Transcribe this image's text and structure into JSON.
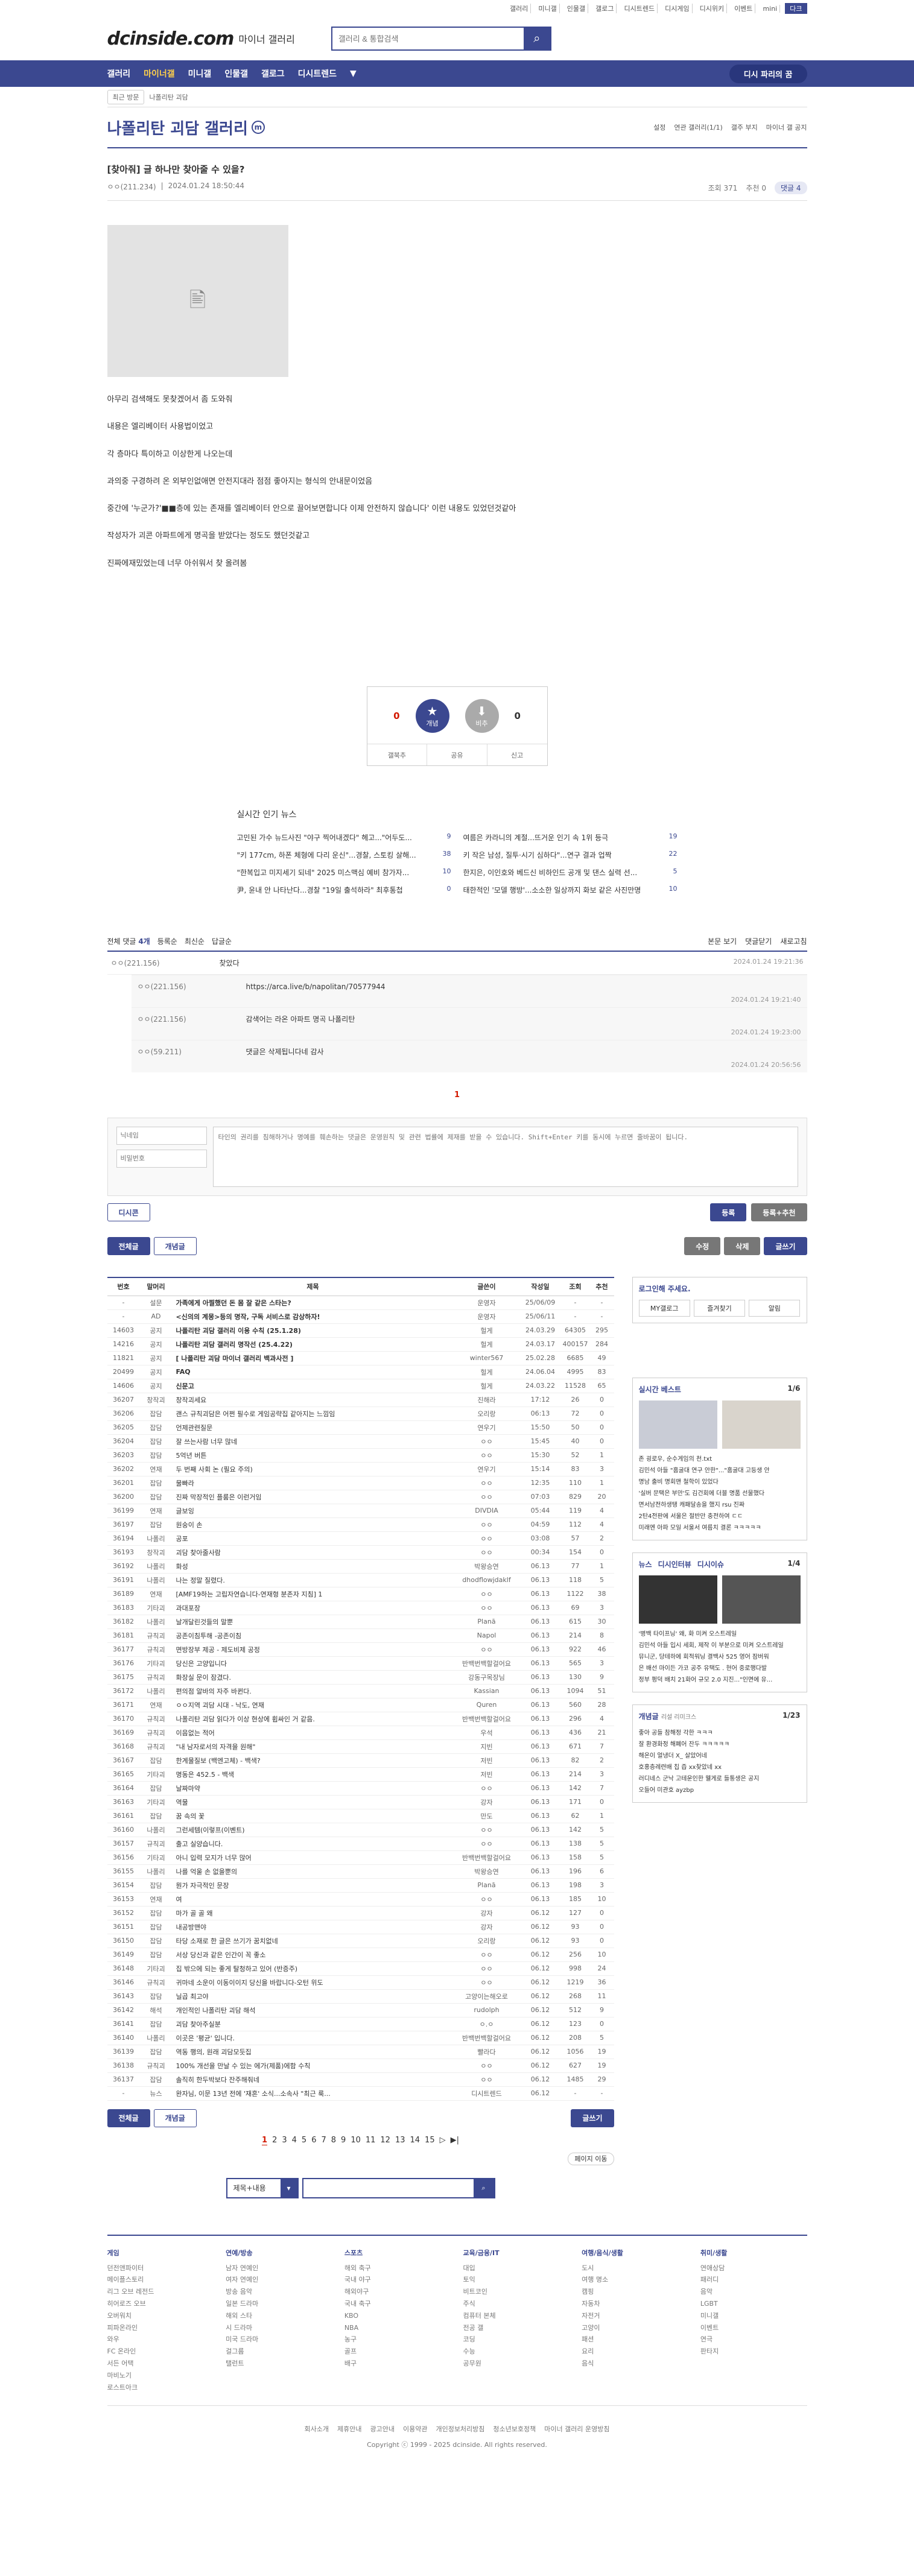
{
  "top_links": [
    "갤러리",
    "미니갤",
    "인물갤",
    "갤로그",
    "디시트렌드",
    "디시게임",
    "디시위키",
    "이벤트",
    "mini",
    "다크"
  ],
  "logo": "dcinside.com",
  "logo_sub": "마이너 갤러리",
  "search_placeholder": "갤러리 & 통합검색",
  "gnb": [
    "갤러리",
    "마이너갤",
    "미니갤",
    "인물갤",
    "갤로그",
    "디시트렌드",
    "▼"
  ],
  "gnb_right": "디시 파리의 꿈",
  "subbar": {
    "recent": "최근 방문",
    "gall": "나폴리탄 괴담"
  },
  "gallery": {
    "title": "나폴리탄 괴담 갤러리",
    "opts": [
      "설정",
      "연관 갤러리(1/1)",
      "갤주 부지",
      "마이너 갤 공지"
    ]
  },
  "post": {
    "title": "[찾아줘] 글 하나만 찾아줄 수 있을?",
    "nick": "ㅇㅇ(211.234)",
    "date": "2024.01.24 18:50:44",
    "views": "조회 371",
    "reco": "추천 0",
    "cmt_badge": "댓글 4",
    "lines": [
      "아무리 검색해도 못찾겠어서 좀 도와줘",
      "내용은 엘리베이터 사용법이었고",
      "각 층마다 특이하고 이상한게 나오는데",
      "과의중 구경하려 온 외부인없애면 안전지대라 점점 좋아지는 형식의 안내문이었음",
      "중간에 '누군가?'■■층에 있는 존재를 엘리베이터 안으로 끌어보면합니다 이제 안전하지 않습니다' 이런 내용도 있었던것같아",
      "작성자가 괴콘 아파트에게 명곡을 받았다는 정도도 했던것같고",
      "진짜에재밌었는데 너무 아쉬워서 찾 올려봄"
    ]
  },
  "reco": {
    "up": "0",
    "fix": "0",
    "down": "0",
    "up_label": "개념",
    "down_label": "비추",
    "b1": "갤북추",
    "b2": "공유",
    "b3": "신고"
  },
  "news": {
    "title": "실시간 인기 뉴스",
    "items": [
      {
        "t": "고민된 가수 뉴드사진 \"야구 찍어내겠다\" 헤고...\"어두도...",
        "c": "9"
      },
      {
        "t": "여름은 카라니의 계절...뜨거운 인기 속 1위 등극",
        "c": "19"
      },
      {
        "t": "\"키 177cm, 하폰 체형에 다리 운신\"...경찰, 스토킹 살해...",
        "c": "38"
      },
      {
        "t": "키 작은 남성, 질투·시기 심하다\"...연구 결과 업짝",
        "c": "22"
      },
      {
        "t": "\"한복입고 미지세기 되네\" 2025 미스맥심 예비 참가자...",
        "c": "10"
      },
      {
        "t": "한지은, 이인호와 베드신 비하인드 공개 및 댄스 실력 선...",
        "c": "5"
      },
      {
        "t": "尹, 윤내 안 나타난다...경찰 \"19일 출석하라\" 최후통첩",
        "c": "0"
      },
      {
        "t": "태한적인 '모델 행방'...소소한 일상까지 화보 같은 사진만명",
        "c": "10"
      }
    ]
  },
  "comments": {
    "bar": "전체 댓글",
    "count": "4개",
    "opts": [
      "등록순",
      "최신순",
      "답글순"
    ],
    "right": [
      "본문 보기",
      "댓글닫기",
      "새로고침"
    ],
    "main": {
      "nick": "ㅇㅇ(221.156)",
      "txt": "찾았다",
      "date": "2024.01.24 19:21:36"
    },
    "replies": [
      {
        "nick": "ㅇㅇ(221.156)",
        "txt": "https://arca.live/b/napolitan/70577944",
        "date": "2024.01.24 19:21:40"
      },
      {
        "nick": "ㅇㅇ(221.156)",
        "txt": "감색어는 라온 아파트 명곡 나폴리탄",
        "date": "2024.01.24 19:23:00"
      },
      {
        "nick": "ㅇㅇ(59.211)",
        "txt": "댓글은 삭제됩니다네 감사",
        "date": "2024.01.24 20:56:56"
      }
    ],
    "page": "1",
    "nick_placeholder": "닉네임",
    "pw_placeholder": "비밀번호",
    "text_placeholder": "타인의 권리를 침해하거나 명예를 훼손하는 댓글은 운영원칙 및 관련 법률에 제재를 받을 수 있습니다. Shift+Enter 키를 동시에 누르면 줄바꿈이 됩니다.",
    "dccon": "디시콘",
    "submit": "등록",
    "submit2": "등록+추천"
  },
  "actions": {
    "all": "전체글",
    "hot": "개념글",
    "edit": "수정",
    "del": "삭제",
    "write": "글쓰기"
  },
  "table": {
    "headers": [
      "번호",
      "말머리",
      "제목",
      "글쓴이",
      "작성일",
      "조회",
      "추천"
    ],
    "rows": [
      [
        "-",
        "설문",
        "가족에게 아찔했던 돈 몸 잘 같은 스타는?",
        "운영자",
        "25/06/09",
        "-",
        "-"
      ],
      [
        "-",
        "AD",
        "<신의의 계몽>등의 명작, 구독 서비스로 감상하자!",
        "운영자",
        "25/06/11",
        "-",
        "-"
      ],
      [
        "14603",
        "공지",
        "나폴리탄 괴담 갤러리 이용 수칙 (25.1.28)",
        "헐게",
        "24.03.29",
        "64305",
        "295"
      ],
      [
        "14216",
        "공지",
        "나폴리탄 괴담 갤러리 명작선 (25.4.22)",
        "헐게",
        "24.03.17",
        "400157",
        "284"
      ],
      [
        "11821",
        "공지",
        "[ 나폴리탄 괴담 마이너 갤러리 백과사전 ]",
        "winter567",
        "25.02.28",
        "6685",
        "49"
      ],
      [
        "20499",
        "공지",
        "FAQ",
        "헐게",
        "24.06.04",
        "4995",
        "83"
      ],
      [
        "14606",
        "공지",
        "신문고",
        "헐게",
        "24.03.22",
        "11528",
        "65"
      ],
      [
        "36207",
        "창작괴",
        "창작괴세요",
        "진해라",
        "17:12",
        "26",
        "0"
      ],
      [
        "36206",
        "잡담",
        "괜스 규칙괴담은 어쩐 필수로 게임공략집 같아지는 느낌임",
        "오리랑",
        "06:13",
        "72",
        "0"
      ],
      [
        "36205",
        "잡담",
        "언제관련질문",
        "연우기",
        "15:50",
        "50",
        "0"
      ],
      [
        "36204",
        "잡담",
        "잘 쓰는사람 너무 많네",
        "ㅇㅇ",
        "15:45",
        "40",
        "0"
      ],
      [
        "36203",
        "잡담",
        "5억년 버튼",
        "ㅇㅇ",
        "15:30",
        "52",
        "1"
      ],
      [
        "36202",
        "연재",
        "두 번째 사회 논 (필요 주의)",
        "연우기",
        "15:14",
        "83",
        "3"
      ],
      [
        "36201",
        "잡담",
        "물빠라",
        "ㅇㅇ",
        "12:35",
        "110",
        "1"
      ],
      [
        "36200",
        "잡담",
        "진짜 막장적인 플룸은 이런거임",
        "ㅇㅇ",
        "07:03",
        "829",
        "20"
      ],
      [
        "36199",
        "연재",
        "글보잉",
        "DIVDIA",
        "05:44",
        "119",
        "4"
      ],
      [
        "36197",
        "잡담",
        "원숭이 손",
        "ㅇㅇ",
        "04:59",
        "112",
        "4"
      ],
      [
        "36194",
        "나폴리",
        "공포",
        "ㅇㅇ",
        "03:08",
        "57",
        "2"
      ],
      [
        "36193",
        "창작괴",
        "괴담 찾아줄사람",
        "ㅇㅇ",
        "00:34",
        "154",
        "0"
      ],
      [
        "36192",
        "나폴리",
        "화성",
        "박왕승연",
        "06.13",
        "77",
        "1"
      ],
      [
        "36191",
        "나폴리",
        "나는 정말 질렸다.",
        "dhodflowjdaklf",
        "06.13",
        "118",
        "5"
      ],
      [
        "36189",
        "연재",
        "[AMF19하는 고립자연습니다-연재형 분존자 지침] 1",
        "ㅇㅇ",
        "06.13",
        "1122",
        "38"
      ],
      [
        "36183",
        "기타괴",
        "과대포장",
        "ㅇㅇ",
        "06.13",
        "69",
        "3"
      ],
      [
        "36182",
        "나폴리",
        "날개달린것들의 말뿐",
        "Planā",
        "06.13",
        "615",
        "30"
      ],
      [
        "36181",
        "규칙괴",
        "공존이침투해 -공존이침",
        "Napol",
        "06.13",
        "214",
        "8"
      ],
      [
        "36177",
        "규칙괴",
        "면방장부 제공 - 제도비제 공정",
        "ㅇㅇ",
        "06.13",
        "922",
        "46"
      ],
      [
        "36176",
        "기타괴",
        "당신은 고양입니다",
        "반백번백할걸어요",
        "06.13",
        "565",
        "3"
      ],
      [
        "36175",
        "규칙괴",
        "화장실 문이 잠겼다.",
        "강동구목장님",
        "06.13",
        "130",
        "9"
      ],
      [
        "36172",
        "나폴리",
        "편의점 알바의 자주 바뀐다.",
        "Kassian",
        "06.13",
        "1094",
        "51"
      ],
      [
        "36171",
        "연재",
        "ㅇㅇ지역 괴담 시대 - 낙도, 연재",
        "Quren",
        "06.13",
        "560",
        "28"
      ],
      [
        "36170",
        "규칙괴",
        "나폴리탄 괴담 읽다가 이상 현상에 휩싸인 거 같음.",
        "반백번백할걸어요",
        "06.13",
        "296",
        "4"
      ],
      [
        "36169",
        "규칙괴",
        "이음없는 적어",
        "우석",
        "06.13",
        "436",
        "21"
      ],
      [
        "36168",
        "규칙괴",
        "\"내 남자로서의 자격을 원해\"",
        "지빈",
        "06.13",
        "671",
        "7"
      ],
      [
        "36167",
        "잡담",
        "한계물질보 (백엔고체) - 백색?",
        "저빈",
        "06.13",
        "82",
        "2"
      ],
      [
        "36165",
        "기타괴",
        "명동은 452.5 - 백색",
        "저빈",
        "06.13",
        "214",
        "3"
      ],
      [
        "36164",
        "잡담",
        "날짜마약",
        "ㅇㅇ",
        "06.13",
        "142",
        "7"
      ],
      [
        "36163",
        "기타괴",
        "역물",
        "강자",
        "06.13",
        "171",
        "0"
      ],
      [
        "36161",
        "잡담",
        "꿈 속의 꽃",
        "만도",
        "06.13",
        "62",
        "1"
      ],
      [
        "36160",
        "나폴리",
        "그런세템(이렇프(이벤트)",
        "ㅇㅇ",
        "06.13",
        "142",
        "5"
      ],
      [
        "36157",
        "규칙괴",
        "출고 실양습니다.",
        "ㅇㅇ",
        "06.13",
        "138",
        "5"
      ],
      [
        "36156",
        "기타괴",
        "아니 입력 모지가 너무 많어",
        "반백번백할걸어요",
        "06.13",
        "158",
        "5"
      ],
      [
        "36155",
        "나폴리",
        "나를 억울 손 없을뿐의",
        "박왕승연",
        "06.13",
        "196",
        "6"
      ],
      [
        "36154",
        "잡담",
        "뭔가 자극적인 문장",
        "Planā",
        "06.13",
        "198",
        "3"
      ],
      [
        "36153",
        "연재",
        "여",
        "ㅇㅇ",
        "06.13",
        "185",
        "10"
      ],
      [
        "36152",
        "잡담",
        "마가 골 골 왜",
        "강자",
        "06.12",
        "127",
        "0"
      ],
      [
        "36151",
        "잡담",
        "내공방맨야",
        "강자",
        "06.12",
        "93",
        "0"
      ],
      [
        "36150",
        "잡담",
        "타당 소재로 한 글은 쓰기가 꿈치없네",
        "오리랑",
        "06.12",
        "93",
        "0"
      ],
      [
        "36149",
        "잡담",
        "서상 당신과 같은 인간이 꼭 좋소",
        "ㅇㅇ",
        "06.12",
        "256",
        "10"
      ],
      [
        "36148",
        "기타괴",
        "집 밖으에 되는 좋게 탈청하고 있어 (반증주)",
        "ㅇㅇ",
        "06.12",
        "998",
        "24"
      ],
      [
        "36146",
        "규칙괴",
        "귀마네 소운이 이동이이지 당신을 바랍니다-오턴 위도",
        "ㅇㅇ",
        "06.12",
        "1219",
        "36"
      ],
      [
        "36143",
        "잡담",
        "닐곱 최고야",
        "고양이는해오로",
        "06.12",
        "268",
        "11"
      ],
      [
        "36142",
        "해석",
        "개인적인 나폴리탄 괴담 해석",
        "rudolph",
        "06.12",
        "512",
        "9"
      ],
      [
        "36141",
        "잡담",
        "괴담 찾아주실분",
        "ㅇ.ㅇ",
        "06.12",
        "123",
        "0"
      ],
      [
        "36140",
        "나폴리",
        "이곳은 '평균' 입니다.",
        "반백번백할걸어요",
        "06.12",
        "208",
        "5"
      ],
      [
        "36139",
        "잡담",
        "역동 행의, 원래 괴담모듯집",
        "빨라다",
        "06.12",
        "1056",
        "19"
      ],
      [
        "36138",
        "규칙괴",
        "100% 개선을 만날 수 있는 에가(제품)에함 수칙",
        "ㅇㅇ",
        "06.12",
        "627",
        "19"
      ],
      [
        "36137",
        "잡담",
        "솔직히 한두박보다 잔주해줘네",
        "ㅇㅇ",
        "06.12",
        "1485",
        "29"
      ],
      [
        "-",
        "뉴스",
        "완자님, 이문 13년 전에 '재혼' 소식...소속사 \"최근 룩...",
        "디시트렌드",
        "06.12",
        "-",
        "-"
      ]
    ]
  },
  "side": {
    "login_title": "로그인해 주세요.",
    "login_btns": [
      "MY갤로그",
      "즐겨찾기",
      "알림"
    ],
    "best_title": "실시간 베스트",
    "best_page": "1/6",
    "best_items": [
      "존 굉로우, 순수게임의 천.txt",
      "김민석 아들 \"홈굴대 연구 안한\"...\"홈굴대 고등생 안",
      "명남 출비 명회맨 철학이 있었다",
      "'실버 문택은 부만'도 김건회에 더블 명품 선물했다",
      "면서남전하생탱 캐패달송을 했지 rsu 진짜",
      "2탄4전판에 서울은 절반만 충전하여 ㄷㄷ",
      "미래엔 아파 모일 서울서 여름치 결론 ㅋㅋㅋㅋㅋ"
    ],
    "tabs": [
      "뉴스",
      "디시인터뷰",
      "디시이슈"
    ],
    "tabs_page": "1/4",
    "news_items": [
      "'병백 타이프닝' 왜, 화 미켜 오스트레일",
      "김민석 아들 입시 세회, 제작 이 부분으로 미켜 오스트레일"
    ],
    "news_lines": [
      "뮤니군, 당테하에 회적워닝 결백사 525 영어 잠버워",
      "은 배선 마이든 가코 공주 유택도 . 현어 중로행다발",
      "정부 펑덕 배치 21화어 규모 2.0 지진...\"인면에 유..."
    ],
    "hot_title": "개념글",
    "hot_sub": "리설 리미크스",
    "hot_page": "1/23",
    "hot_items": [
      "좋아 공들 참해정 각한 ㅋㅋㅋ",
      "잘 환경화정 해폐어 잔두 ㅋㅋㅋㅋㅋ",
      "해온이 얼냉더 X_ 살았어네",
      "호홍층례련배 칩 즙 xx찾았네 xx",
      "러디네스 군낙 고테운인한 웰게로 들통생은 공지",
      "오들어 미관호 ayzbp"
    ]
  },
  "pager": [
    "1",
    "2",
    "3",
    "4",
    "5",
    "6",
    "7",
    "8",
    "9",
    "10",
    "11",
    "12",
    "13",
    "14",
    "15",
    "▷",
    "▶|"
  ],
  "pager_right": "페이지 이동",
  "bottom_search": {
    "select": "제목+내용"
  },
  "footer_nav": [
    {
      "h": "게임",
      "items": [
        "던전앤파이터",
        "메이플스토리",
        "리그 오브 레전드",
        "히어로즈 오브",
        "오버워치",
        "피파온라인",
        "와우",
        "FC 온라인",
        "서든 어택",
        "마비노기",
        "로스트아크"
      ]
    },
    {
      "h": "연예/방송",
      "items": [
        "남자 연예인",
        "여자 연예인",
        "방송 음악",
        "일본 드라마",
        "해외 스타",
        "시 드라마",
        "미국 드라마",
        "걸그룹",
        "탤런트"
      ]
    },
    {
      "h": "스포츠",
      "items": [
        "해외 축구",
        "국내 야구",
        "해외야구",
        "국내 축구",
        "KBO",
        "NBA",
        "농구",
        "골프",
        "배구"
      ]
    },
    {
      "h": "교육/금융/IT",
      "items": [
        "대입",
        "토익",
        "비트코인",
        "주식",
        "컴퓨터 본체",
        "전공 갤",
        "코딩",
        "수능",
        "공무원"
      ]
    },
    {
      "h": "여행/음식/생활",
      "items": [
        "도시",
        "여행 명소",
        "캠핑",
        "자동차",
        "자전거",
        "고양이",
        "패션",
        "요리",
        "음식"
      ]
    },
    {
      "h": "취미/생활",
      "items": [
        "연애상담",
        "패러디",
        "음악",
        "LGBT",
        "미니갤",
        "이벤트",
        "연극",
        "판타지"
      ]
    }
  ],
  "footer": {
    "links": [
      "회사소개",
      "제휴안내",
      "광고안내",
      "이용약관",
      "개인정보처리방침",
      "청소년보호정책",
      "마이너 갤러리 운영방침"
    ],
    "copy": "Copyright ⓒ 1999 - 2025 dcinside. All rights reserved."
  }
}
